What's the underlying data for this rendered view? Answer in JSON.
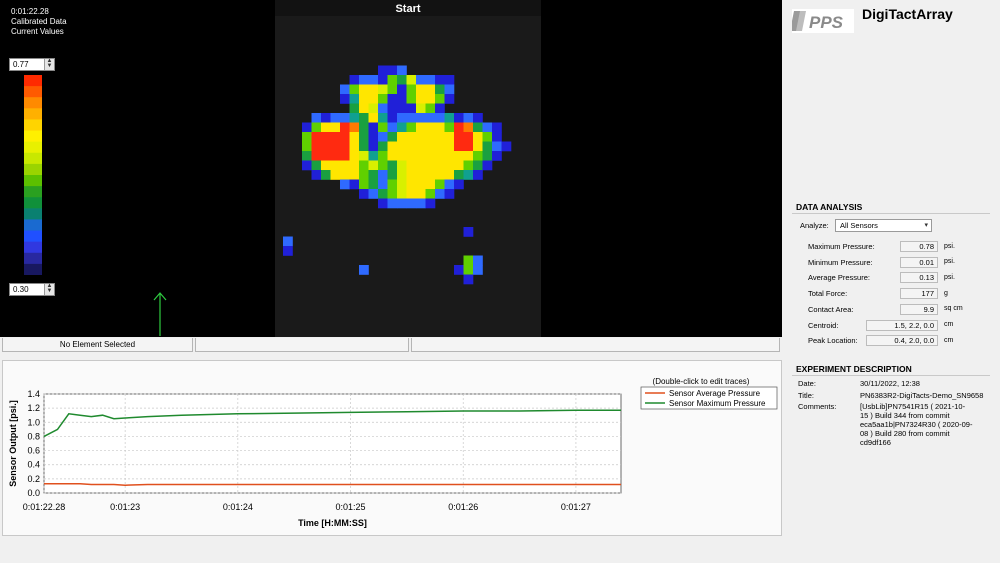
{
  "viewer": {
    "time": "0:01:22.28",
    "line2": "Calibrated Data",
    "line3": "Current Values",
    "max_value": "0.77",
    "min_value": "0.30",
    "title": "Start"
  },
  "status": {
    "cell1": "No Element Selected",
    "cell2": "",
    "cell3": ""
  },
  "right": {
    "app_name": "DigiTactArray",
    "logo_text": "PPS",
    "analysis": {
      "title": "DATA ANALYSIS",
      "analyze_label": "Analyze:",
      "analyze_value": "All Sensors",
      "rows": [
        {
          "label": "Maximum Pressure:",
          "value": "0.78",
          "unit": "psi."
        },
        {
          "label": "Minimum Pressure:",
          "value": "0.01",
          "unit": "psi."
        },
        {
          "label": "Average Pressure:",
          "value": "0.13",
          "unit": "psi."
        },
        {
          "label": "Total Force:",
          "value": "177",
          "unit": "g"
        },
        {
          "label": "Contact Area:",
          "value": "9.9",
          "unit": "sq cm"
        },
        {
          "label": "Centroid:",
          "value": "1.5, 2.2, 0.0",
          "unit": "cm"
        },
        {
          "label": "Peak Location:",
          "value": "0.4, 2.0, 0.0",
          "unit": "cm"
        }
      ]
    },
    "experiment": {
      "title": "EXPERIMENT DESCRIPTION",
      "date_label": "Date:",
      "date_value": "30/11/2022, 12:38",
      "title_label": "Title:",
      "title_value": "PN6383R2-DigiTacts-Demo_SN9658",
      "comments_label": "Comments:",
      "comments_lines": [
        "[UsbLib]PN7541R15  ( 2021-10-",
        "15 )   Build 344 from commit",
        "eca5aa1b|PN7324R30  ( 2020-09-",
        "08 )   Build 280 from commit",
        "cd9df166"
      ]
    }
  },
  "colors": {
    "avg_trace": "#e0501e",
    "max_trace": "#1f8a2e",
    "arrow": "#2ecc40"
  },
  "chart_data": {
    "type": "line",
    "title": "",
    "xlabel": "Time [H:MM:SS]",
    "ylabel": "Sensor Output [psi.]",
    "ylim": [
      0,
      1.4
    ],
    "yticks": [
      "0.0",
      "0.2",
      "0.4",
      "0.6",
      "0.8",
      "1.0",
      "1.2",
      "1.4"
    ],
    "xticks": [
      "0:01:22.28",
      "0:01:23",
      "0:01:24",
      "0:01:25",
      "0:01:26",
      "0:01:27"
    ],
    "legend_note": "(Double-click to edit traces)",
    "legend_position": "top-right",
    "grid": true,
    "x": [
      22.28,
      22.4,
      22.5,
      22.6,
      22.7,
      22.8,
      22.9,
      23.0,
      23.2,
      23.5,
      24.0,
      24.5,
      25.0,
      25.5,
      26.0,
      26.5,
      27.0,
      27.4
    ],
    "series": [
      {
        "name": "Sensor Average Pressure",
        "values": [
          0.13,
          0.13,
          0.13,
          0.13,
          0.12,
          0.12,
          0.12,
          0.11,
          0.12,
          0.12,
          0.12,
          0.12,
          0.12,
          0.12,
          0.12,
          0.12,
          0.12,
          0.12
        ]
      },
      {
        "name": "Sensor Maximum Pressure",
        "values": [
          0.8,
          0.9,
          1.12,
          1.1,
          1.08,
          1.1,
          1.05,
          1.06,
          1.08,
          1.1,
          1.12,
          1.13,
          1.14,
          1.15,
          1.16,
          1.16,
          1.17,
          1.17
        ]
      }
    ]
  }
}
